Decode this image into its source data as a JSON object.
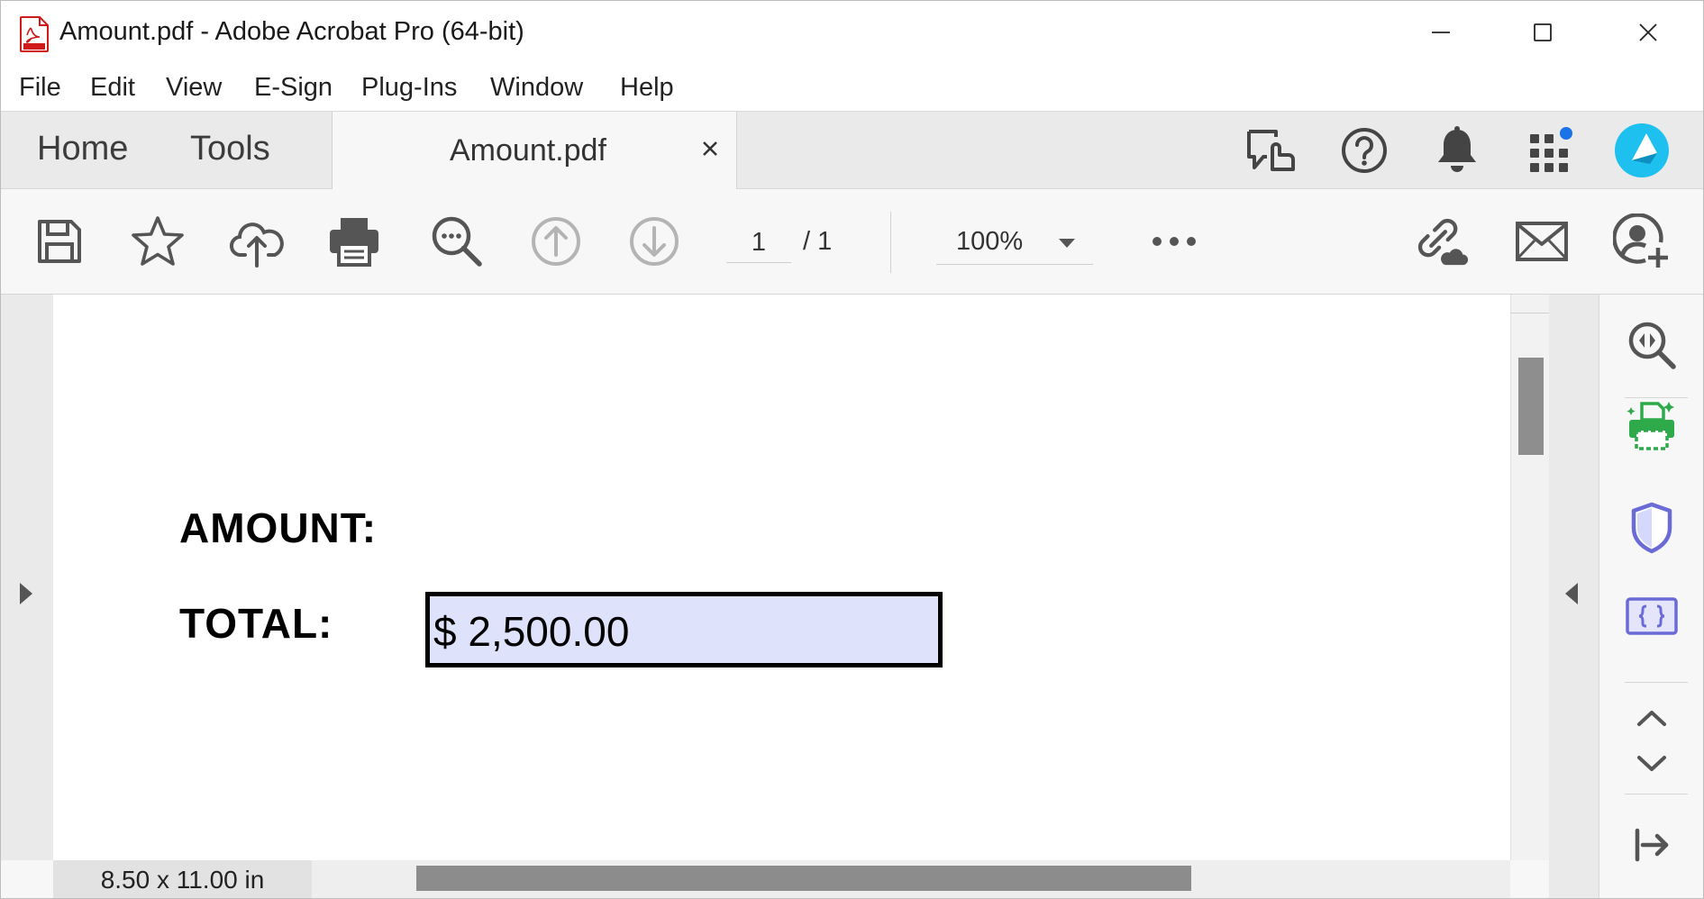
{
  "window": {
    "title": "Amount.pdf - Adobe Acrobat Pro (64-bit)"
  },
  "menu": [
    "File",
    "Edit",
    "View",
    "E-Sign",
    "Plug-Ins",
    "Window",
    "Help"
  ],
  "tabs": {
    "home": "Home",
    "tools": "Tools",
    "document": "Amount.pdf"
  },
  "toolbar": {
    "page_current": "1",
    "page_total": "/  1",
    "zoom": "100%"
  },
  "document": {
    "amount_label": "AMOUNT:",
    "total_label": "TOTAL:",
    "total_value": "$ 2,500.00"
  },
  "status": {
    "page_size": "8.50 x 11.00 in"
  },
  "icons": {
    "header": [
      "share-review-icon",
      "help-icon",
      "notifications-bell-icon",
      "apps-grid-icon",
      "user-avatar-icon"
    ],
    "toolbar": [
      "save-icon",
      "bookmark-star-icon",
      "cloud-upload-icon",
      "print-icon",
      "find-text-icon",
      "previous-page-icon",
      "next-page-icon",
      "more-options-icon",
      "share-link-icon",
      "email-icon",
      "add-user-icon"
    ],
    "right_rail": [
      "zoom-search-icon",
      "print-production-icon",
      "protect-shield-icon",
      "prepare-form-icon",
      "chevron-up-icon",
      "chevron-down-icon",
      "collapse-panel-icon"
    ]
  },
  "colors": {
    "field_fill": "#dfe2fb",
    "notification_dot": "#1a73e8",
    "avatar": "#1ec0f0",
    "green_tool": "#2eaa4a",
    "purple_tool": "#6b6bd8"
  }
}
